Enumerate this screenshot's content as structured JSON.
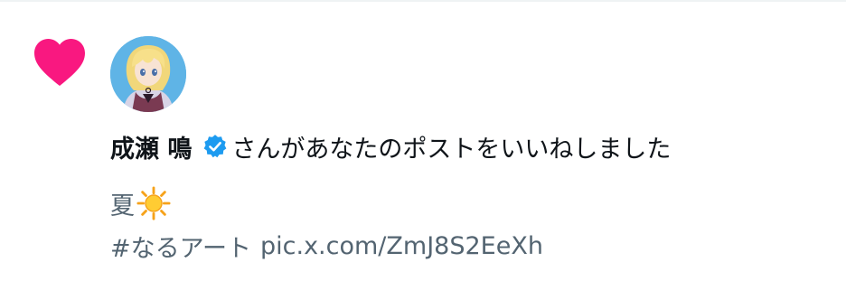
{
  "notification": {
    "type": "like",
    "user_name": "成瀬 鳴",
    "verified": true,
    "action_text": "さんがあなたのポストをいいねしました",
    "post_text": "夏",
    "post_emoji": "sun-emoji",
    "hashtag": "#なるアート",
    "link": "pic.x.com/ZmJ8S2EeXh"
  },
  "colors": {
    "heart": "#f91880",
    "verified": "#1d9bf0",
    "primary_text": "#0f1419",
    "secondary_text": "#536471",
    "divider": "#eff3f4",
    "avatar_bg": "#5fb4e6"
  }
}
